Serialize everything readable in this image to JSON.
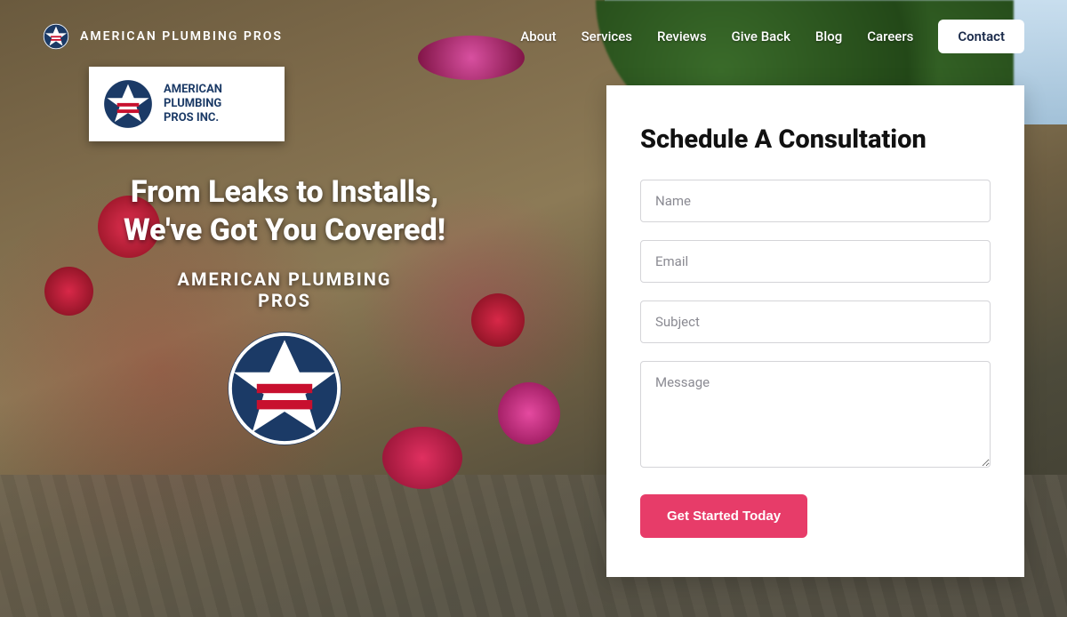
{
  "brand": {
    "name": "AMERICAN PLUMBING PROS"
  },
  "nav": {
    "items": [
      "About",
      "Services",
      "Reviews",
      "Give Back",
      "Blog",
      "Careers"
    ],
    "contact": "Contact"
  },
  "sign": {
    "line1": "AMERICAN",
    "line2": "PLUMBING",
    "line3": "PROS INC."
  },
  "hero": {
    "headline_l1": "From Leaks to Installs,",
    "headline_l2": "We've Got You Covered!",
    "subhead_l1": "AMERICAN PLUMBING",
    "subhead_l2": "PROS"
  },
  "form": {
    "title": "Schedule A Consultation",
    "name_ph": "Name",
    "email_ph": "Email",
    "subject_ph": "Subject",
    "message_ph": "Message",
    "submit": "Get Started Today"
  },
  "colors": {
    "accent": "#e73c69",
    "navy": "#1b3a66"
  }
}
